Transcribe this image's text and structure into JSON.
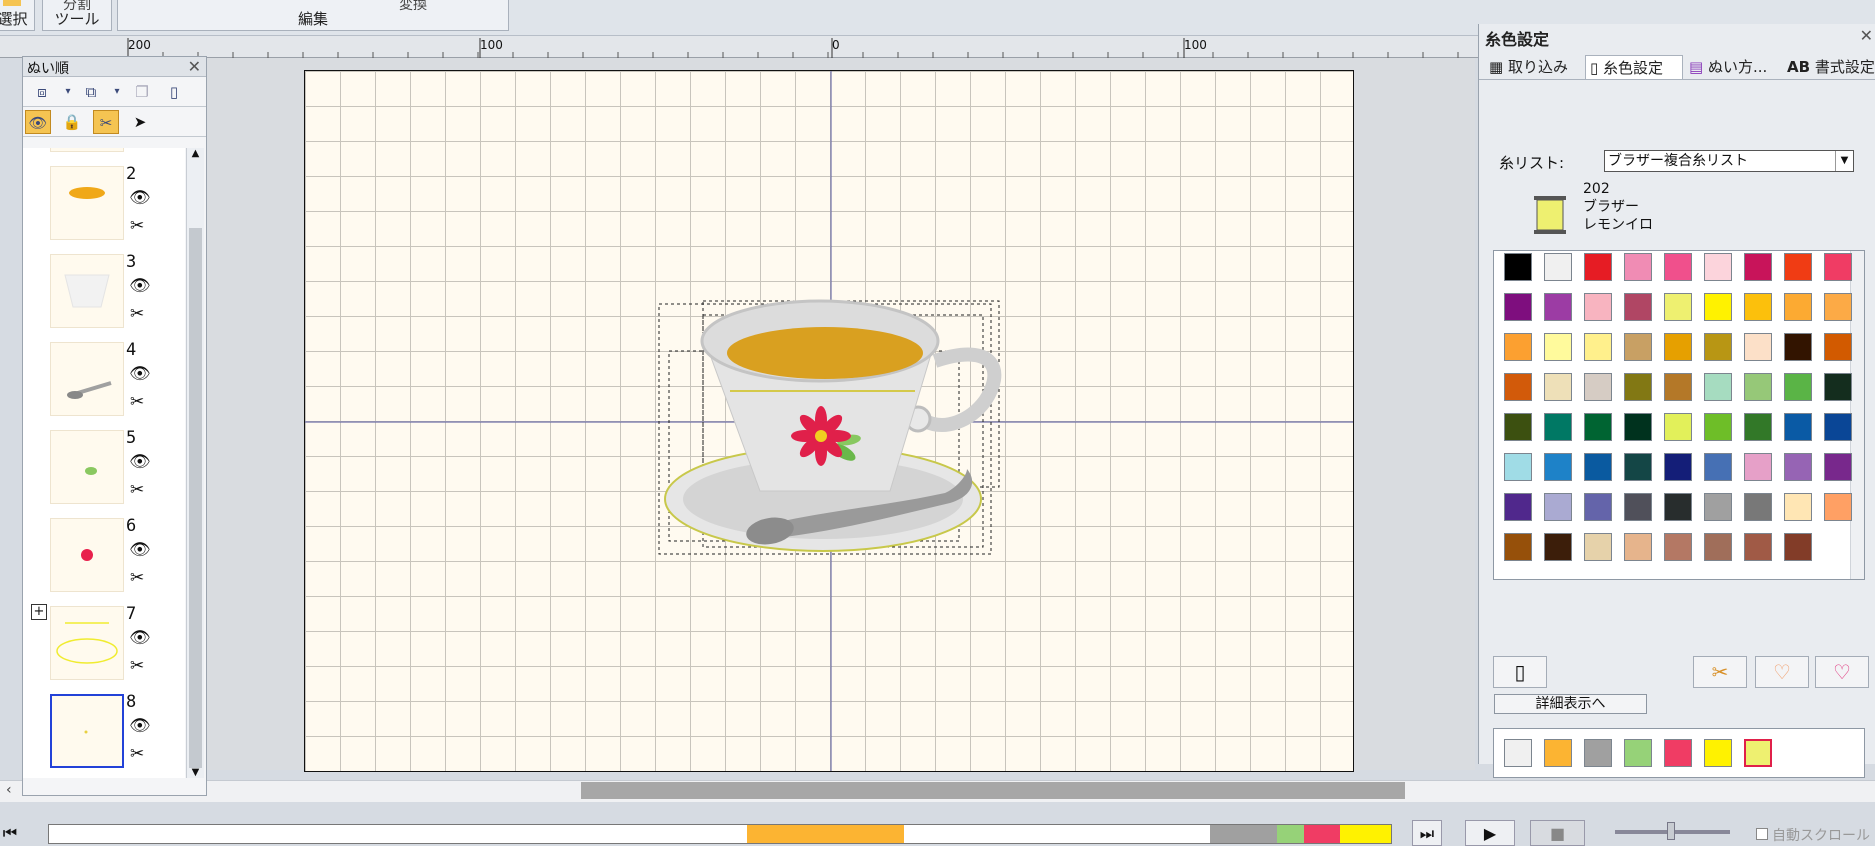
{
  "ribbon": {
    "groups": [
      {
        "label": "選択",
        "top": ""
      },
      {
        "label": "ツール",
        "top": "分割"
      },
      {
        "label": "編集",
        "top": "変換"
      }
    ]
  },
  "ruler": {
    "ticks": [
      "200",
      "100",
      "0",
      "100"
    ]
  },
  "sew_order": {
    "title": "ぬい順",
    "close": "✕",
    "items": [
      {
        "number": "2"
      },
      {
        "number": "3"
      },
      {
        "number": "4"
      },
      {
        "number": "5"
      },
      {
        "number": "6"
      },
      {
        "number": "7"
      },
      {
        "number": "8"
      }
    ]
  },
  "thread_panel": {
    "title": "糸色設定",
    "close": "✕",
    "tabs": [
      "取り込み",
      "糸色設定",
      "ぬい方...",
      "書式設定"
    ],
    "thread_list_label": "糸リスト:",
    "thread_list_value": "ブラザー複合糸リスト",
    "selected_code": "202",
    "selected_brand": "ブラザー",
    "selected_name": "レモンイロ",
    "detail_button": "詳細表示へ",
    "swatches": [
      "#000000",
      "#f0f0f0",
      "#e61c24",
      "#f08cb4",
      "#f0508c",
      "#fcd4dc",
      "#c8145a",
      "#f03c14",
      "#f03c64",
      "#7e0e7e",
      "#9c3ca4",
      "#f8b4c0",
      "#b04664",
      "#eef070",
      "#fff200",
      "#fcc00c",
      "#fcaa32",
      "#fcaa46",
      "#fca030",
      "#fffa9c",
      "#fff08c",
      "#c8a064",
      "#e6a000",
      "#b89614",
      "#fce0c8",
      "#321400",
      "#d25a00",
      "#d25a0a",
      "#eee0b8",
      "#d6ccc4",
      "#827814",
      "#b47828",
      "#a6dcc0",
      "#96c878",
      "#5ab446",
      "#142d1e",
      "#3c5010",
      "#007864",
      "#006432",
      "#00321e",
      "#e2f05a",
      "#6ebe28",
      "#327828",
      "#0a5aa5",
      "#0a4696",
      "#a0dce6",
      "#1e82c8",
      "#0a5aa0",
      "#144646",
      "#141e78",
      "#4670b4",
      "#e6a0c8",
      "#9664b4",
      "#78288c",
      "#50288c",
      "#aaaad2",
      "#6464aa",
      "#50505a",
      "#282d2d",
      "#a0a0a0",
      "#787878",
      "#ffe6b4",
      "#ffa064",
      "#96500a",
      "#3c1e0a",
      "#e6d2aa",
      "#e6b48c",
      "#b47864",
      "#a06e5a",
      "#a05a46",
      "#823c28"
    ],
    "used_colors": [
      "#f0f0f0",
      "#fcb432",
      "#a0a0a0",
      "#96d278",
      "#f03c64",
      "#fff200",
      "#eef070"
    ]
  },
  "timeline": {
    "segments": [
      {
        "color": "#ffffff",
        "frac": 0.52
      },
      {
        "color": "#fcb432",
        "frac": 0.117
      },
      {
        "color": "#ffffff",
        "frac": 0.228
      },
      {
        "color": "#a0a0a0",
        "frac": 0.05
      },
      {
        "color": "#96d278",
        "frac": 0.02
      },
      {
        "color": "#f03c64",
        "frac": 0.027
      },
      {
        "color": "#fff200",
        "frac": 0.038
      }
    ],
    "auto_scroll": "自動スクロール"
  }
}
